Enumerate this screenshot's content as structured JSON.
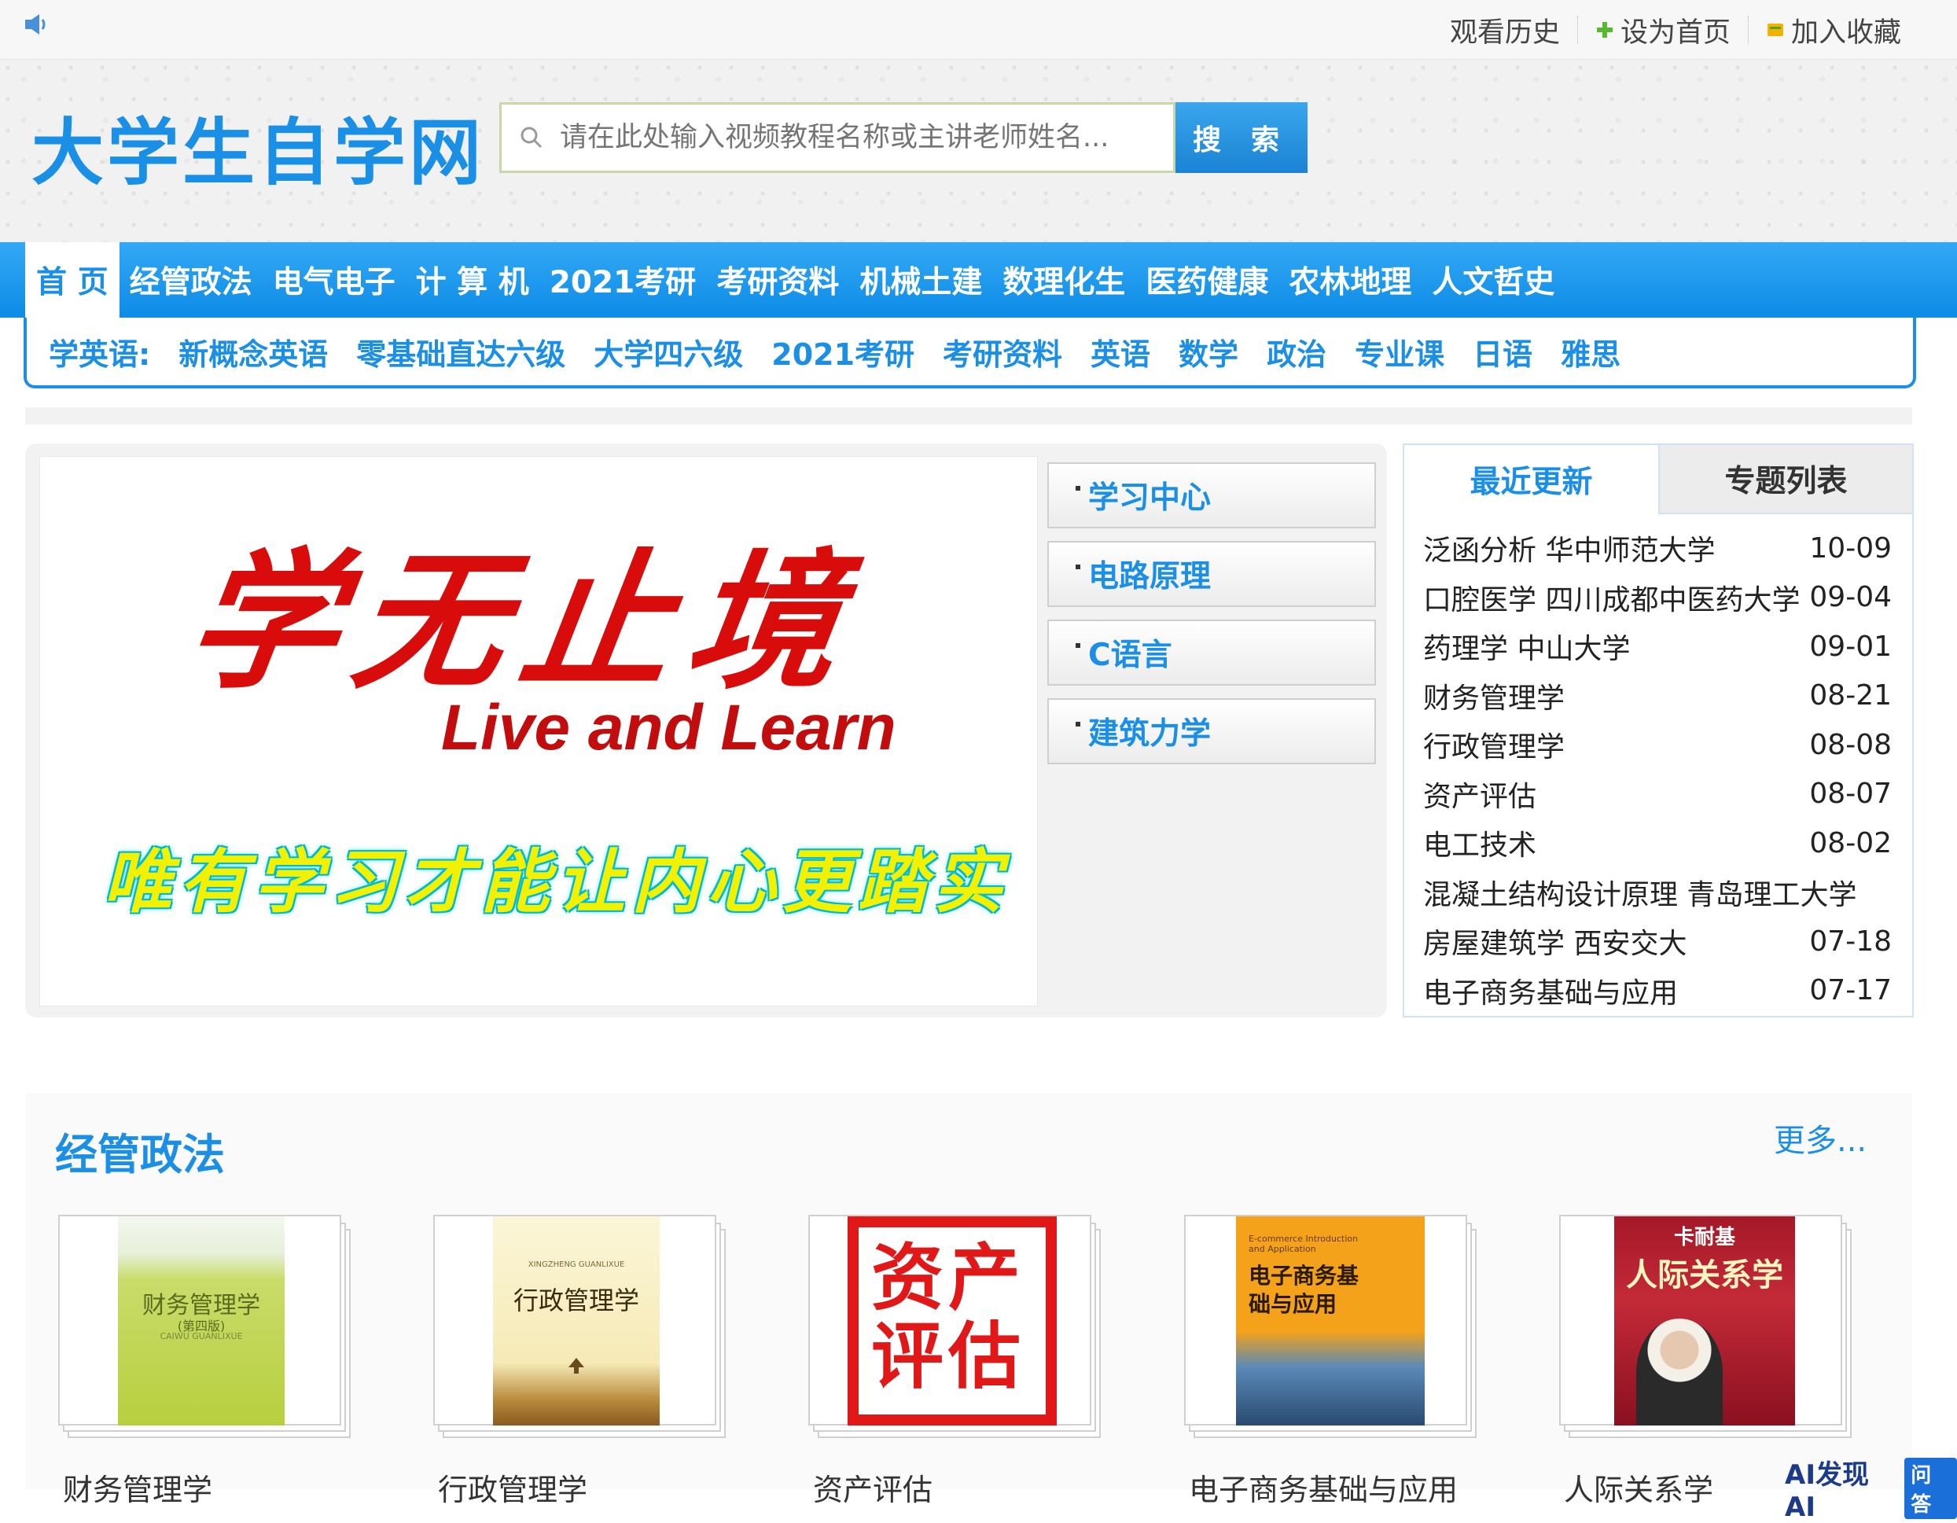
{
  "topbar": {
    "links": [
      "观看历史",
      "设为首页",
      "加入收藏"
    ]
  },
  "header": {
    "logo": "大学生自学网",
    "search_placeholder": "请在此处输入视频教程名称或主讲老师姓名...",
    "search_button": "搜 索"
  },
  "main_nav": [
    "首 页",
    "经管政法",
    "电气电子",
    "计 算 机",
    "2021考研",
    "考研资料",
    "机械土建",
    "数理化生",
    "医药健康",
    "农林地理",
    "人文哲史"
  ],
  "sub_nav": [
    "学英语:",
    "新概念英语",
    "零基础直达六级",
    "大学四六级",
    "2021考研",
    "考研资料",
    "英语",
    "数学",
    "政治",
    "专业课",
    "日语",
    "雅思"
  ],
  "banner": {
    "title_cn": "学无止境",
    "title_en": "Live and Learn",
    "motto": "唯有学习才能让内心更踏实"
  },
  "quick_links": [
    "学习中心",
    "电路原理",
    "C语言",
    "建筑力学"
  ],
  "right_panel": {
    "tabs": [
      "最近更新",
      "专题列表"
    ],
    "updates": [
      {
        "title": "泛函分析 华中师范大学",
        "date": "10-09"
      },
      {
        "title": "口腔医学 四川成都中医药大学",
        "date": "09-04"
      },
      {
        "title": "药理学 中山大学",
        "date": "09-01"
      },
      {
        "title": "财务管理学",
        "date": "08-21"
      },
      {
        "title": "行政管理学",
        "date": "08-08"
      },
      {
        "title": "资产评估",
        "date": "08-07"
      },
      {
        "title": "电工技术",
        "date": "08-02"
      },
      {
        "title": "混凝土结构设计原理 青岛理工大学",
        "date": ""
      },
      {
        "title": "房屋建筑学 西安交大",
        "date": "07-18"
      },
      {
        "title": "电子商务基础与应用",
        "date": "07-17"
      }
    ]
  },
  "section": {
    "title": "经管政法",
    "more": "更多...",
    "books": [
      {
        "cover_title": "财务管理学",
        "cover_sub": "(第四版)",
        "cover_tag": "CAIWU GUANLIXUE",
        "caption": "财务管理学"
      },
      {
        "cover_title": "行政管理学",
        "cover_tag": "XINGZHENG GUANLIXUE",
        "caption": "行政管理学"
      },
      {
        "cover_title": "资产评估",
        "caption": "资产评估"
      },
      {
        "cover_title": "电子商务基础与应用",
        "cover_sub": "E-commerce Introduction and Application",
        "caption": "电子商务基础与应用"
      },
      {
        "cover_title": "人际关系学",
        "cover_sub": "卡耐基",
        "caption": "人际关系学"
      }
    ]
  },
  "watermark": {
    "brand": "AI发现AI",
    "badge": "问答"
  },
  "colors": {
    "accent": "#1b8fe6",
    "nav": "#1b8fe6",
    "banner_red": "#d90c0c",
    "motto_yellow": "#f2f200"
  }
}
